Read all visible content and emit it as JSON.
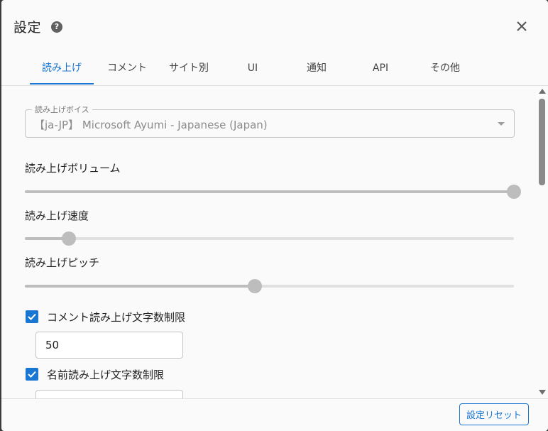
{
  "dialog": {
    "title": "設定"
  },
  "tabs": [
    {
      "label": "読み上げ",
      "active": true
    },
    {
      "label": "コメント",
      "active": false
    },
    {
      "label": "サイト別",
      "active": false
    },
    {
      "label": "UI",
      "active": false
    },
    {
      "label": "通知",
      "active": false
    },
    {
      "label": "API",
      "active": false
    },
    {
      "label": "その他",
      "active": false
    }
  ],
  "voice": {
    "label": "読み上げボイス",
    "value": "【ja-JP】 Microsoft Ayumi - Japanese (Japan)"
  },
  "sliders": {
    "volume": {
      "label": "読み上げボリューム",
      "value_fraction": 1.0
    },
    "speed": {
      "label": "読み上げ速度",
      "value_fraction": 0.09
    },
    "pitch": {
      "label": "読み上げピッチ",
      "value_fraction": 0.47
    }
  },
  "comment_limit": {
    "label": "コメント読み上げ文字数制限",
    "checked": true,
    "value": "50"
  },
  "name_limit": {
    "label": "名前読み上げ文字数制限",
    "checked": true,
    "value": ""
  },
  "footer": {
    "reset_label": "設定リセット"
  },
  "colors": {
    "accent": "#1976d2",
    "slider_disabled": "#bdbdbd"
  }
}
